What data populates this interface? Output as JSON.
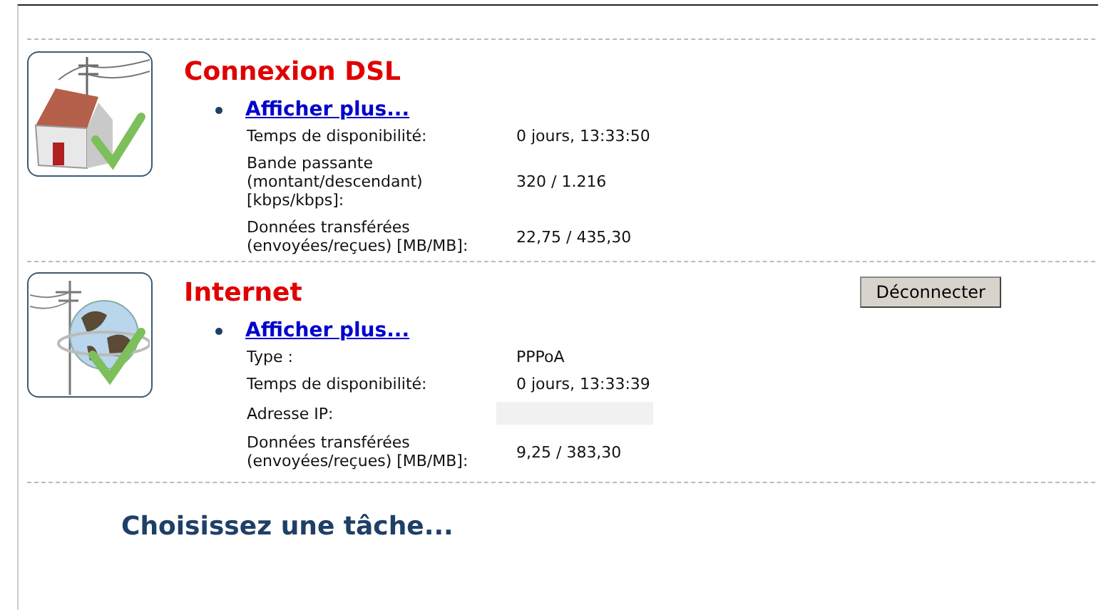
{
  "sections": [
    {
      "kind": "house",
      "title": "Connexion DSL",
      "link": "Afficher plus...",
      "rows": [
        {
          "label": "Temps de disponibilité:",
          "value": "0 jours, 13:33:50"
        },
        {
          "label": "Bande passante (montant/descendant) [kbps/kbps]:",
          "value": "320 / 1.216"
        },
        {
          "label": "Données transférées (envoyées/reçues) [MB/MB]:",
          "value": "22,75 / 435,30"
        }
      ]
    },
    {
      "kind": "globe",
      "title": "Internet",
      "button": "Déconnecter",
      "link": "Afficher plus...",
      "rows": [
        {
          "label": "Type :",
          "value": "PPPoA"
        },
        {
          "label": "Temps de disponibilité:",
          "value": "0 jours, 13:33:39"
        },
        {
          "label": "Adresse IP:",
          "redacted": true
        },
        {
          "label": "Données transférées (envoyées/reçues) [MB/MB]:",
          "value": "9,25 / 383,30"
        }
      ]
    }
  ],
  "task_heading": "Choisissez une tâche..."
}
